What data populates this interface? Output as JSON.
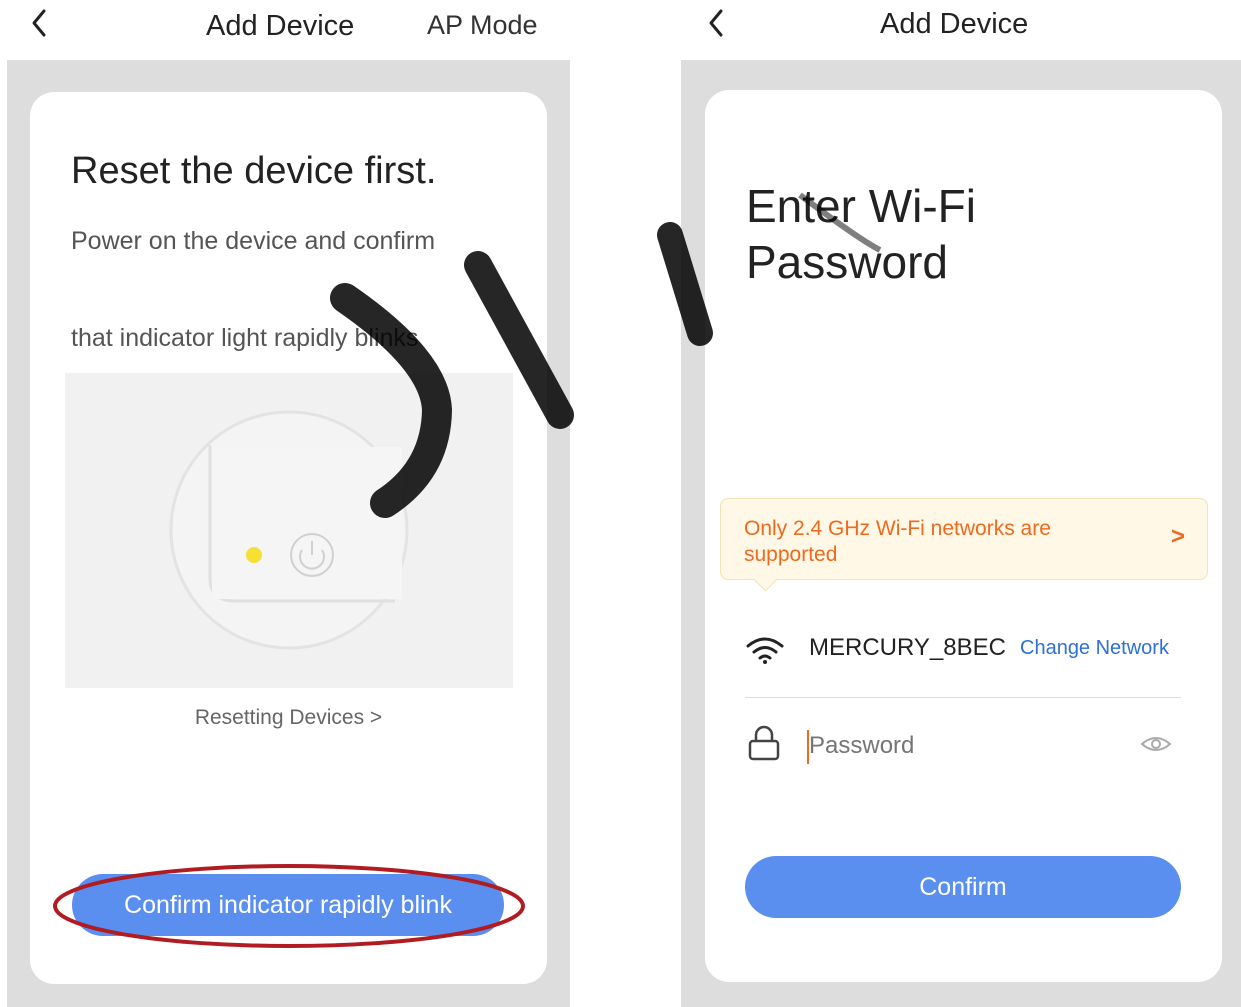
{
  "left_screen": {
    "nav": {
      "back_icon": "chevron-left",
      "title": "Add Device",
      "action": "AP Mode"
    },
    "heading": "Reset the device first.",
    "instruction_line1": "Power on the device and confirm",
    "instruction_line2": "that indicator light rapidly blinks",
    "illustration": {
      "indicator_color": "#f7e034",
      "power_icon": "power-icon"
    },
    "resetting_link": "Resetting Devices >",
    "confirm_button": "Confirm indicator rapidly blink",
    "highlight_color": "#b01c22"
  },
  "right_screen": {
    "nav": {
      "back_icon": "chevron-left",
      "title": "Add Device"
    },
    "heading_line1": "Enter Wi-Fi",
    "heading_line2": "Password",
    "notice": {
      "text_line1": "Only 2.4 GHz Wi-Fi networks are",
      "text_line2": "supported",
      "arrow": ">",
      "color": "#ee6a1f"
    },
    "network": {
      "icon": "wifi-icon",
      "ssid": "MERCURY_8BEC",
      "change_label": "Change Network"
    },
    "password_field": {
      "icon": "lock-icon",
      "placeholder": "Password",
      "value": "",
      "toggle_icon": "eye-icon"
    },
    "confirm_button": "Confirm"
  },
  "colors": {
    "primary_blue": "#5b8fef",
    "link_blue": "#2f6fd8",
    "page_grey": "#dddddd"
  }
}
